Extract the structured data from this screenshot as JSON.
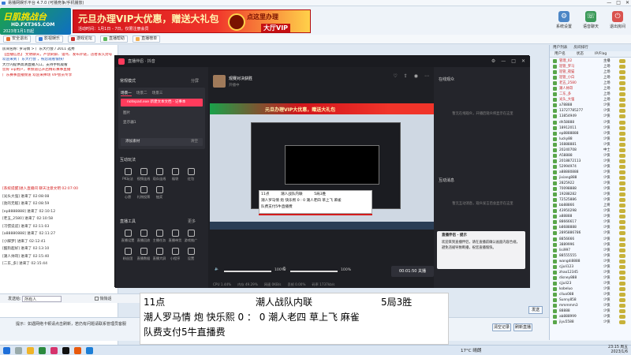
{
  "window": {
    "title": "易播网娱乐平台 4.7.0 (可播竞争/手机播放)",
    "controls": [
      "—",
      "□",
      "✕"
    ]
  },
  "header": {
    "logo_main": "日肌挑战台",
    "logo_url": "HD.FXT365.COM",
    "logo_sub": "2023年1月1日起",
    "banner_title": "元旦办理VIP大优惠，赠送大礼包",
    "banner_sub": "活动时间：1月1日 - 7日，仅限注册会员",
    "banner_right_title": "点这里办理",
    "banner_right_btn": "大厅VIP",
    "right_icons": [
      {
        "label": "系统设置",
        "icon": "gear-icon"
      },
      {
        "label": "语音聊天",
        "icon": "voice-icon"
      },
      {
        "label": "退出房间",
        "icon": "exit-icon"
      }
    ]
  },
  "toolbar": {
    "buttons": [
      "安全退出",
      "影视娱乐",
      "游戏论坛",
      "直播帮助",
      "直播榜单"
    ]
  },
  "room_info": [
    "房间名称: 罗马情 > 广东大行会 / 2011 选秀",
    "【直播信息】 文明聊天，严禁刷屏、谩骂、发布外链，违者永久封号",
    "欢迎来到 广东大行会 ，祝您观看愉快！",
    "大厅内提供高清直播入口，支持手机观看",
    "您好 vip用户，本频道已开启精彩赛事直播",
    "广东赛事直播频道 欢迎来捧场 VIP会员专享"
  ],
  "chat_log": [
    "[系统提醒]进入直播间 聊天注意文明 02:07:00",
    "[光头大强] 进来了 02:08:08",
    "[劲的无敌] 进来了 02:08:59",
    "[ep8888888] 进来了 02:10:12",
    "[老五_2580] 进来了 02:10:58",
    "[习惯说谎] 进来了 02:11:03",
    "[a88880888] 进来了 02:11:27",
    "[小脚梦] 进来了 02:12:41",
    "[酷狗超好] 进来了 02:13:10",
    "[潮人帅哥] 进来了 02:15:40",
    "[二东_多] 进来了 02:15:44"
  ],
  "message_bar": {
    "target_label": "发送给:",
    "target_value": "所有人",
    "checkbox_label": "悄悄话",
    "send_label": "发送"
  },
  "bottom": {
    "hint": "提示：如遇网络卡顿请点击刷新，若仍有问题请联系管理员客服",
    "btn_clear": "清空记录",
    "btn_refresh": "刷新直播"
  },
  "userlist": {
    "tabs": [
      "用户列表",
      "房间排行"
    ],
    "columns": [
      "用户名",
      "状态",
      "IP/Flag"
    ],
    "users": [
      {
        "name": "管理_02",
        "status": "主播"
      },
      {
        "name": "巡管_罗马",
        "status": "上场"
      },
      {
        "name": "巡管_夜猫",
        "status": "上场"
      },
      {
        "name": "巡管_小白",
        "status": "上场"
      },
      {
        "name": "老五_2580",
        "status": "上场"
      },
      {
        "name": "潮人帅哥",
        "status": "上场"
      },
      {
        "name": "二东_多",
        "status": "上场"
      },
      {
        "name": "光头_大强",
        "status": "上场"
      },
      {
        "name": "a78888",
        "status": "少侠"
      },
      {
        "name": "13727785277",
        "status": "少侠"
      },
      {
        "name": "13854949",
        "status": "少侠"
      },
      {
        "name": "dh58888",
        "status": "少侠"
      },
      {
        "name": "18912011",
        "status": "少侠"
      },
      {
        "name": "ep8888888",
        "status": "少侠"
      },
      {
        "name": "lucky88",
        "status": "少侠"
      },
      {
        "name": "16888881",
        "status": "少侠"
      },
      {
        "name": "20240708",
        "status": "中士"
      },
      {
        "name": "A58888",
        "status": "少侠"
      },
      {
        "name": "2018872113",
        "status": "少侠"
      },
      {
        "name": "52994974",
        "status": "少侠"
      },
      {
        "name": "a88880888",
        "status": "少侠"
      },
      {
        "name": "jixiang888",
        "status": "少侠"
      },
      {
        "name": "2825922",
        "status": "少侠"
      },
      {
        "name": "70098888",
        "status": "少侠"
      },
      {
        "name": "19288282",
        "status": "少侠"
      },
      {
        "name": "72525886",
        "status": "少侠"
      },
      {
        "name": "bb88866",
        "status": "上将"
      },
      {
        "name": "43950298",
        "status": "少侠"
      },
      {
        "name": "a88888",
        "status": "少侠"
      },
      {
        "name": "88666617",
        "status": "少侠"
      },
      {
        "name": "b8688888",
        "status": "少侠"
      },
      {
        "name": "2895886786",
        "status": "少侠"
      },
      {
        "name": "8856666",
        "status": "少侠"
      },
      {
        "name": "3889996",
        "status": "少侠"
      },
      {
        "name": "lisi997",
        "status": "少侠"
      },
      {
        "name": "88555555",
        "status": "少侠"
      },
      {
        "name": "wangdi8888",
        "status": "少侠"
      },
      {
        "name": "cjjuli123",
        "status": "少侠"
      },
      {
        "name": "zhao12345",
        "status": "少侠"
      },
      {
        "name": "disney888",
        "status": "少侠"
      },
      {
        "name": "cjjuli23",
        "status": "少侠"
      },
      {
        "name": "kobeluo",
        "status": "少侠"
      },
      {
        "name": "clluo088",
        "status": "少侠"
      },
      {
        "name": "Sunny858",
        "status": "少侠"
      },
      {
        "name": "mmmmm3",
        "status": "少侠"
      },
      {
        "name": "88888",
        "status": "少侠"
      },
      {
        "name": "ab888999",
        "status": "少侠"
      },
      {
        "name": "jiyu5588",
        "status": "少侠"
      }
    ]
  },
  "stream_window": {
    "app_title": "直播伴侣 · 抖音",
    "controls": [
      "⚙",
      "—",
      "□",
      "✕"
    ],
    "scene_header": "常规模式",
    "scene_action": "分屏",
    "scene_tabs": [
      "场景一",
      "场景二",
      "场景三"
    ],
    "scene_item": "notepad.exe 新建文本文档 - 记事本",
    "sources": [
      "图片",
      "显示器1"
    ],
    "add_source": "添加素材",
    "add_source_hint": "清空",
    "interact_header": "互动玩法",
    "interact_items": [
      "PK玩法",
      "视频连线",
      "观众连线",
      "福袋",
      "红包",
      "心愿",
      "礼物投票",
      "抽奖"
    ],
    "tools_header": "直播工具",
    "tools_more": "更多",
    "tools_items": [
      "直播设置",
      "直播回放",
      "主播任务",
      "直播带货",
      "游戏推广",
      "粉丝团",
      "直播数据",
      "直播大屏",
      "小程序",
      "设置"
    ],
    "streamer_name": "观赛对决获胜",
    "streamer_sub": "开播中",
    "preview_banner": "元旦办理VIP大优惠，赠送大礼包",
    "preview_caption": [
      "11点          潮人战队内联          5局3胜",
      "潮人罗马情 炮 快乐熙 0 : 0 潮人老四 草上飞 麻雀",
      "队费支付5牛直播费"
    ],
    "audio_pct1": "100%",
    "audio_pct2": "100%",
    "end_btn": "00:01:50 关播",
    "stats": [
      "CPU 1.44%",
      "内存 49.29%",
      "网速 0KB/s",
      "丢帧 0.00%",
      "码率 1737kb/s"
    ],
    "right_top_header": "在线观众",
    "right_top_empty": "暂无在线观众，开播后观众将显示在这里",
    "right_bottom_header": "互动消息",
    "right_bottom_empty": "暂无互动消息，观众发言后会显示在这里",
    "tip_title": "直播伴侣 · 提示",
    "tip_text": "欢迎来到直播伴侣，请在直播前确认画面内容合规，避免违规导致断播，祝您直播愉快。"
  },
  "caption": {
    "line1_time": "11点",
    "line1_title": "潮人战队内联",
    "line1_format": "5局3胜",
    "line2": "潮人罗马情  炮  快乐熙  0 ：  0  潮人老四  草上飞  麻雀",
    "line3": "队费支付5牛直播费"
  },
  "taskbar": {
    "weather": "17°C 晴朗",
    "time": "23:15 周五",
    "date": "2023/1/6"
  },
  "colors": {
    "accent": "#ff3b5c",
    "brand_red": "#d2141b",
    "brand_green": "#1aa34a"
  }
}
